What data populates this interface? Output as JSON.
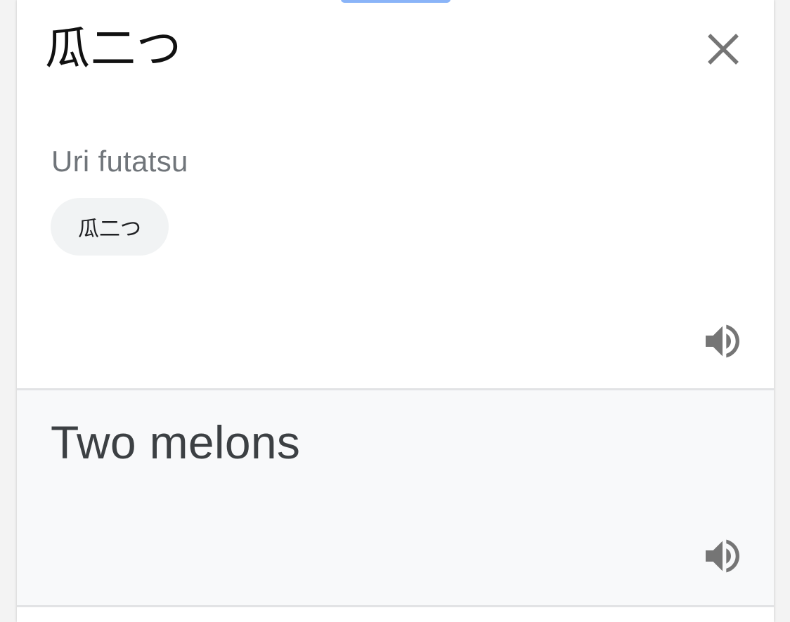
{
  "source": {
    "text": "瓜二つ",
    "romanization": "Uri futatsu",
    "chip_label": "瓜二つ"
  },
  "icons": {
    "close": "close-icon",
    "speaker": "volume-up-icon"
  },
  "translation": {
    "text": "Two melons"
  },
  "colors": {
    "accent": "#8ab4f8",
    "icon": "#757575",
    "result_background": "#f8f9fa",
    "secondary_text": "#70757a"
  }
}
